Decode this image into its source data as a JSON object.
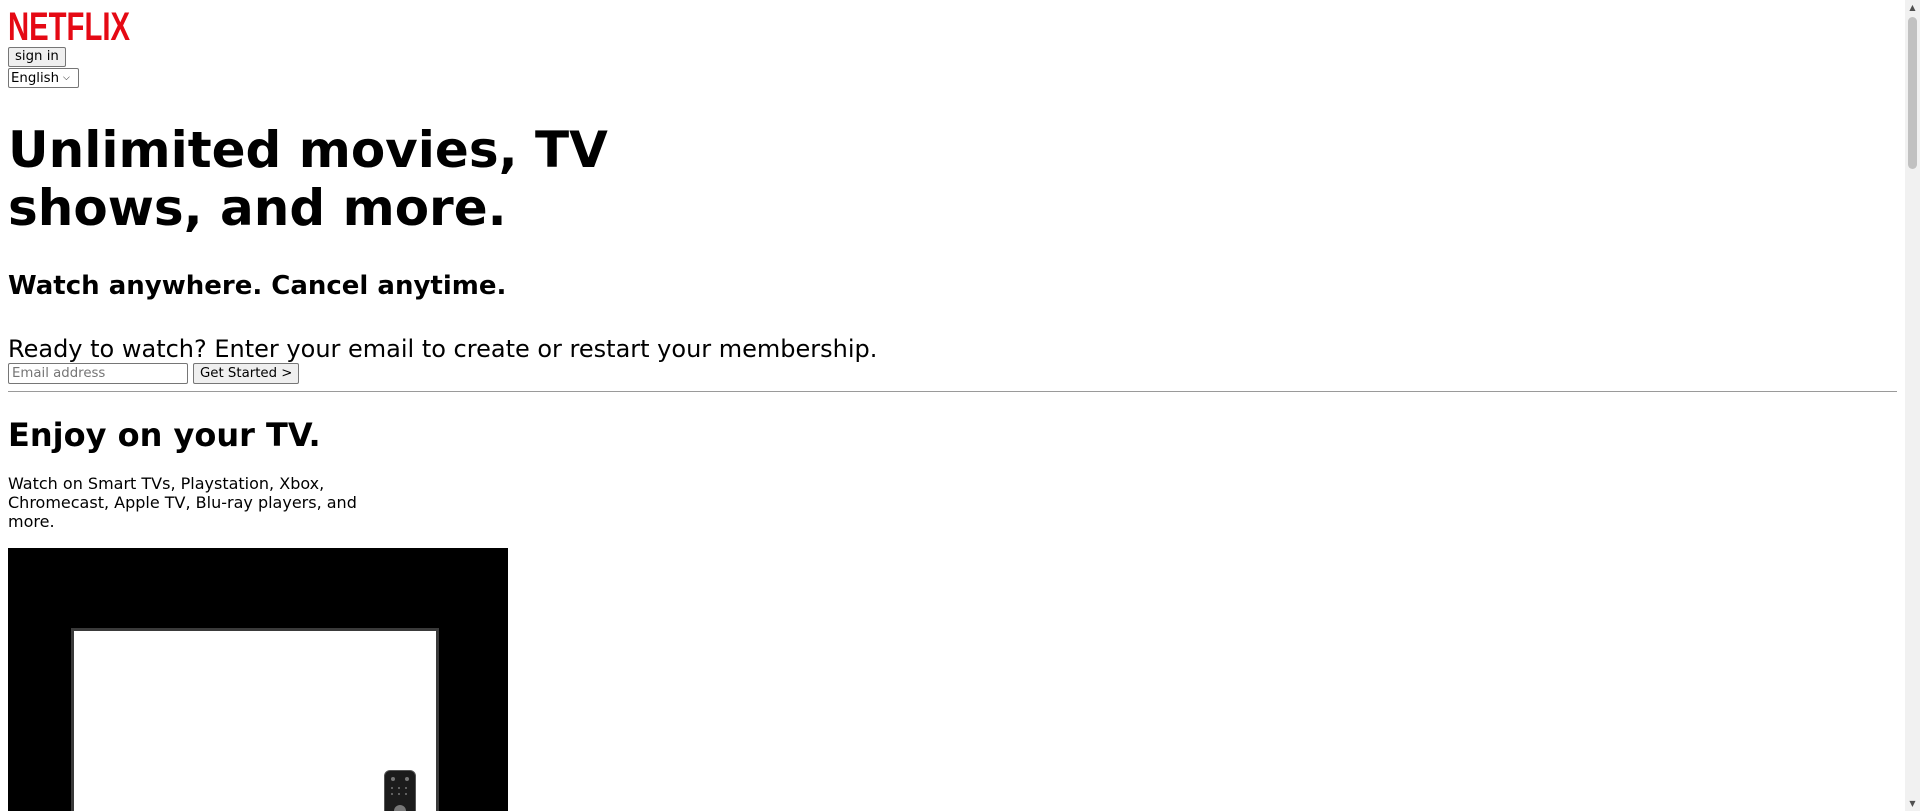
{
  "header": {
    "logo_text": "NETFLIX",
    "brand_color": "#E50914",
    "signin_label": "sign in",
    "language_selected": "English"
  },
  "hero": {
    "title": "Unlimited movies, TV shows, and more.",
    "subtitle": "Watch anywhere. Cancel anytime.",
    "cta_text": "Ready to watch? Enter your email to create or restart your membership.",
    "email_placeholder": "Email address",
    "get_started_label": "Get Started >"
  },
  "tv_section": {
    "title": "Enjoy on your TV.",
    "description": "Watch on Smart TVs, Playstation, Xbox, Chromecast, Apple TV, Blu-ray players, and more."
  },
  "icons": {
    "scroll_up": "scroll-up-arrow-icon",
    "scroll_down": "scroll-down-arrow-icon",
    "language_chevron": "chevron-down-icon"
  }
}
